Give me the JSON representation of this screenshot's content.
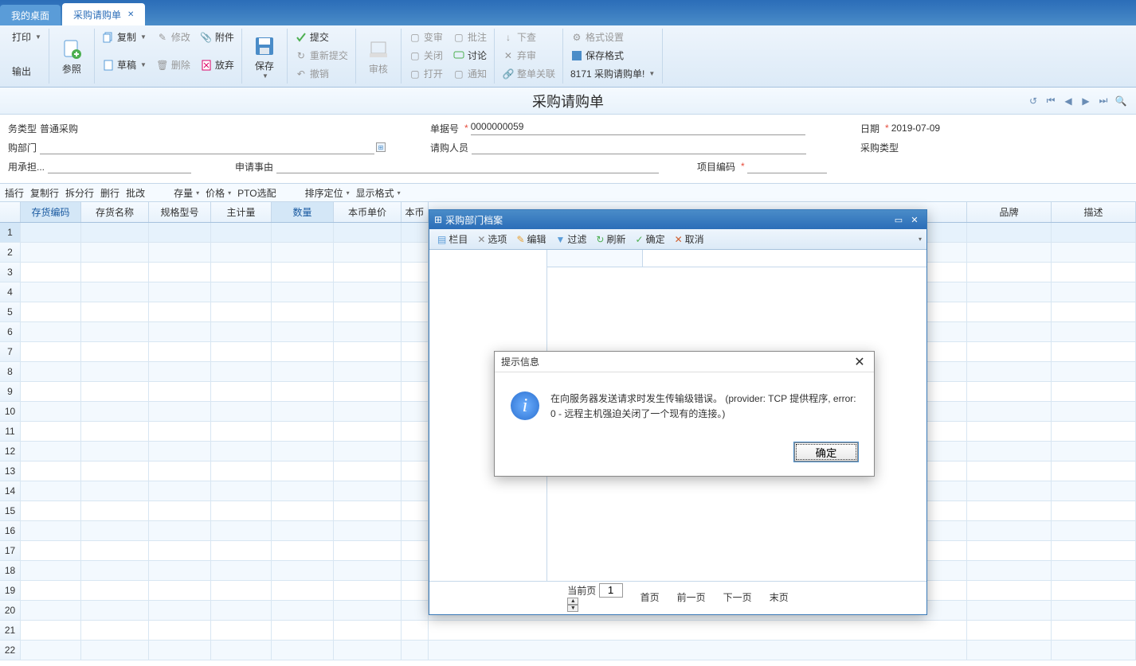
{
  "tabs": {
    "t0": "我的桌面",
    "t1": "采购请购单"
  },
  "ribbon": {
    "print": "打印",
    "output": "输出",
    "ref": "参照",
    "copy": "复制",
    "modify": "修改",
    "attach": "附件",
    "draft": "草稿",
    "delete": "删除",
    "giveup": "放弃",
    "save": "保存",
    "submit": "提交",
    "resubmit": "重新提交",
    "revoke": "撤销",
    "audit": "审核",
    "change": "变审",
    "close": "关闭",
    "open": "打开",
    "batch": "批注",
    "discuss": "讨论",
    "notify": "通知",
    "search": "下查",
    "link": "整单关联",
    "abandon": "弃审",
    "fmtset": "格式设置",
    "fmtsave": "保存格式",
    "fmtcode": "8171 采购请购单!"
  },
  "page_title": "采购请购单",
  "form": {
    "biztype": {
      "label": "务类型",
      "value": "普通采购"
    },
    "dept": {
      "label": "购部门"
    },
    "acceptor": {
      "label": "用承担..."
    },
    "docno": {
      "label": "单据号",
      "value": "0000000059"
    },
    "requester": {
      "label": "请购人员"
    },
    "reason": {
      "label": "申请事由"
    },
    "projcode": {
      "label": "项目编码"
    },
    "date": {
      "label": "日期",
      "value": "2019-07-09"
    },
    "purtype": {
      "label": "采购类型"
    }
  },
  "subtb": {
    "insrow": "插行",
    "copyrow": "复制行",
    "splitrow": "拆分行",
    "delrow": "删行",
    "batch": "批改",
    "stock": "存量",
    "price": "价格",
    "pto": "PTO选配",
    "sort": "排序定位",
    "dispfmt": "显示格式"
  },
  "grid": {
    "cols": [
      "存货编码",
      "存货名称",
      "规格型号",
      "主计量",
      "数量",
      "本币单价",
      "本币",
      "品牌",
      "描述"
    ],
    "rows": 22
  },
  "lookup": {
    "title": "采购部门档案",
    "tb": {
      "columns": "栏目",
      "options": "选项",
      "edit": "编辑",
      "filter": "过滤",
      "refresh": "刷新",
      "ok": "确定",
      "cancel": "取消"
    },
    "pager": {
      "curpage": "当前页",
      "pageval": "1",
      "first": "首页",
      "prev": "前一页",
      "next": "下一页",
      "last": "末页"
    }
  },
  "alert": {
    "title": "提示信息",
    "message": "在向服务器发送请求时发生传输级错误。 (provider: TCP 提供程序, error: 0 - 远程主机强迫关闭了一个现有的连接。)",
    "ok": "确定"
  }
}
